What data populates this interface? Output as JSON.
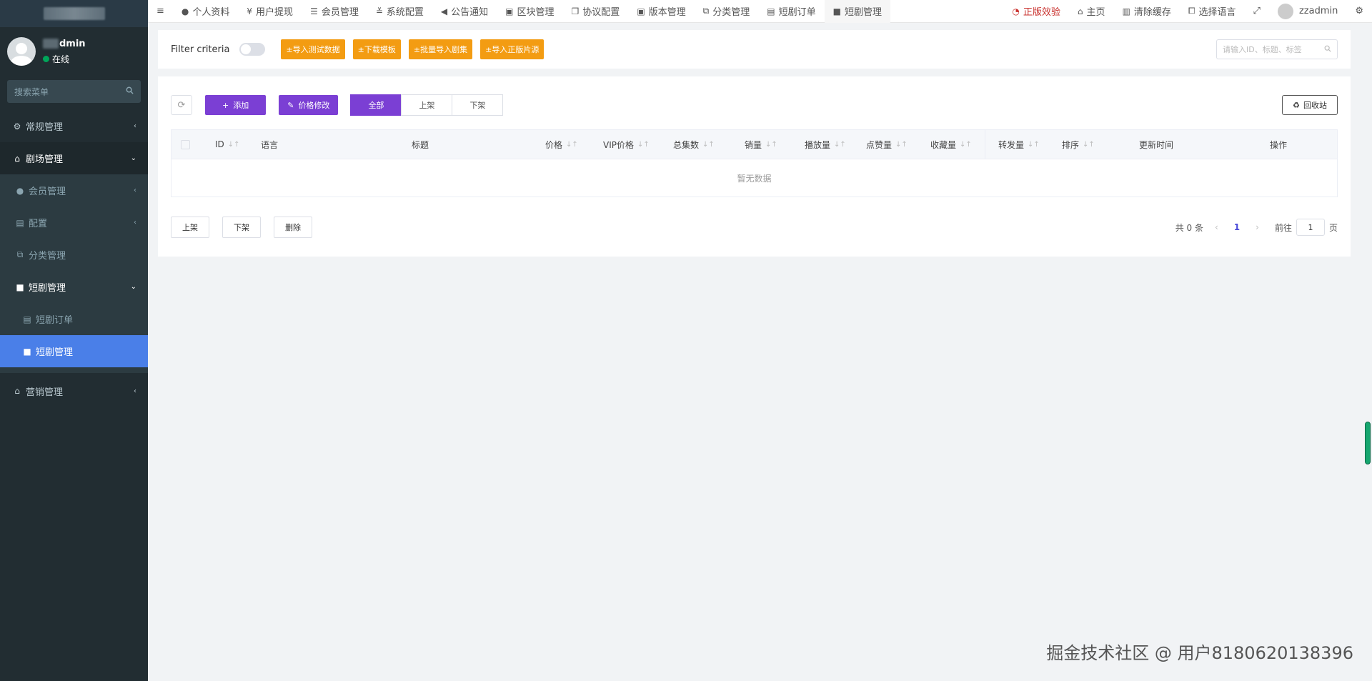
{
  "sidebar": {
    "user": {
      "name_suffix": "dmin",
      "status": "在线"
    },
    "search_placeholder": "搜索菜单",
    "items": [
      {
        "label": "常规管理"
      },
      {
        "label": "剧场管理"
      },
      {
        "label": "会员管理"
      },
      {
        "label": "配置"
      },
      {
        "label": "分类管理"
      },
      {
        "label": "短剧管理"
      },
      {
        "label": "短剧订单"
      },
      {
        "label": "短剧管理"
      },
      {
        "label": "营销管理"
      }
    ]
  },
  "topnav": {
    "tabs": [
      "个人资料",
      "用户提现",
      "会员管理",
      "系统配置",
      "公告通知",
      "区块管理",
      "协议配置",
      "版本管理",
      "分类管理",
      "短剧订单",
      "短剧管理"
    ],
    "right": {
      "genuine": "正版效验",
      "home": "主页",
      "clear_cache": "清除缓存",
      "language": "选择语言",
      "username": "zzadmin"
    }
  },
  "filter": {
    "label": "Filter criteria",
    "buttons": [
      "±导入测试数据",
      "±下载模板",
      "±批量导入剧集",
      "±导入正版片源"
    ],
    "search_placeholder": "请输入ID、标题、标签"
  },
  "toolbar": {
    "add": "添加",
    "price_edit": "价格修改",
    "segments": [
      "全部",
      "上架",
      "下架"
    ],
    "recycle": "回收站"
  },
  "table": {
    "columns": [
      "ID",
      "语言",
      "标题",
      "价格",
      "VIP价格",
      "总集数",
      "销量",
      "播放量",
      "点赞量",
      "收藏量",
      "转发量",
      "排序",
      "更新时间",
      "操作"
    ],
    "empty_text": "暂无数据"
  },
  "bottom": {
    "buttons": [
      "上架",
      "下架",
      "删除"
    ],
    "total": "共 0 条",
    "current_page": "1",
    "goto_label": "前往",
    "goto_value": "1",
    "page_suffix": "页"
  },
  "watermark": "掘金技术社区 @ 用户8180620138396",
  "colors": {
    "sidebar": "#222d32",
    "active": "#4a7fe8",
    "purple": "#7b3fd4",
    "orange": "#f39c12"
  }
}
